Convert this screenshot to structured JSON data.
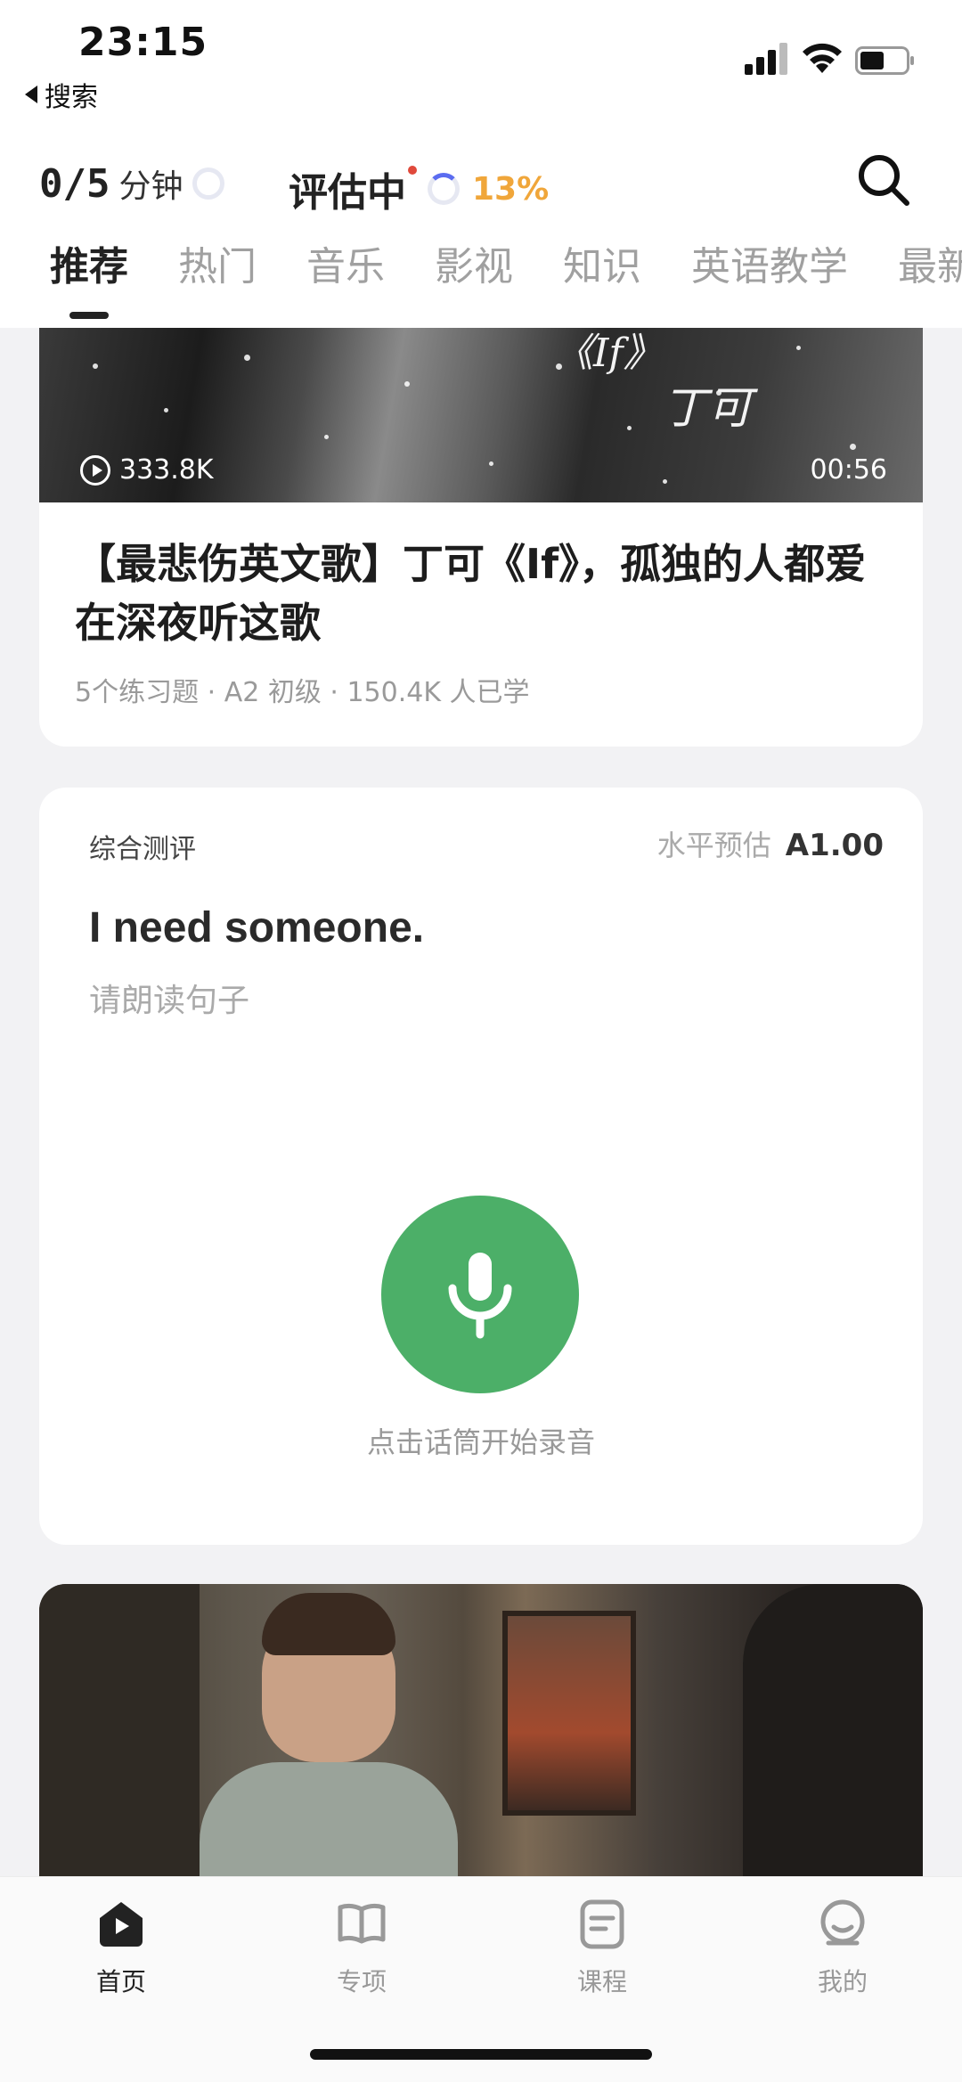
{
  "status_bar": {
    "time": "23:15",
    "back_label": "搜索"
  },
  "header": {
    "minutes_value": "0/5",
    "minutes_unit": "分钟",
    "assess_label": "评估中",
    "assess_percent": "13%"
  },
  "tabs": [
    "推荐",
    "热门",
    "音乐",
    "影视",
    "知识",
    "英语教学",
    "最新"
  ],
  "video_card": {
    "thumb_title": "《If》",
    "thumb_artist": "丁可",
    "views": "333.8K",
    "duration": "00:56",
    "title": "【最悲伤英文歌】丁可《If》，孤独的人都爱在深夜听这歌",
    "meta": "5个练习题 · A2 初级 · 150.4K 人已学"
  },
  "assessment_card": {
    "label": "综合测评",
    "level_key": "水平预估",
    "level_value": "A1.00",
    "sentence": "I need someone.",
    "instruction": "请朗读句子",
    "mic_hint": "点击话筒开始录音"
  },
  "bottom_nav": [
    {
      "label": "首页",
      "icon": "home-play-icon",
      "active": true
    },
    {
      "label": "专项",
      "icon": "book-icon",
      "active": false
    },
    {
      "label": "课程",
      "icon": "course-icon",
      "active": false
    },
    {
      "label": "我的",
      "icon": "profile-icon",
      "active": false
    }
  ],
  "colors": {
    "accent_green": "#4caf68",
    "percent_orange": "#f0a63a",
    "notify_red": "#e0493b"
  }
}
